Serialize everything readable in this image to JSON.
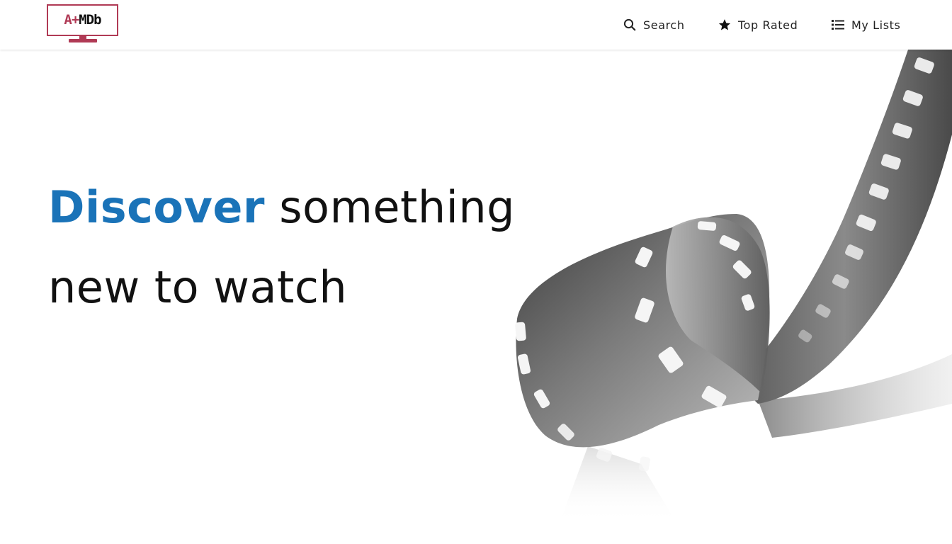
{
  "header": {
    "logo": {
      "accent_text": "A+",
      "main_text": "MDb"
    },
    "nav": [
      {
        "label": "Search",
        "icon": "search-icon"
      },
      {
        "label": "Top Rated",
        "icon": "star-icon"
      },
      {
        "label": "My Lists",
        "icon": "list-icon"
      }
    ]
  },
  "hero": {
    "accent_word": "Discover",
    "line1_rest": "something",
    "line2": "new to watch",
    "image": "film-reel-illustration"
  },
  "colors": {
    "accent_blue": "#1a73b8",
    "logo_red": "#b03a55",
    "text": "#111111"
  }
}
